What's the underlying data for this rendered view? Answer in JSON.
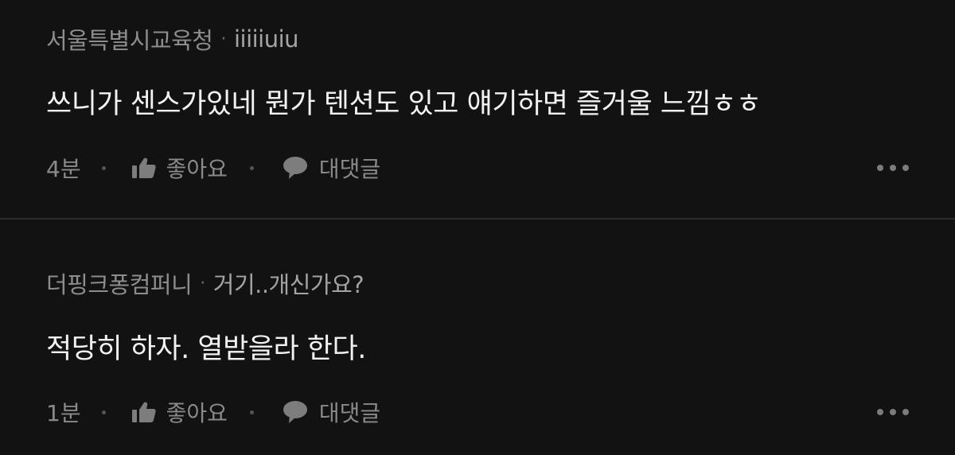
{
  "comments": [
    {
      "company": "서울특별시교육청",
      "separator": "·",
      "nickname": "iiiiiuiu",
      "text": "쓰니가 센스가있네 뭔가 텐션도 있고 얘기하면 즐거울 느낌ㅎㅎ",
      "time": "4분",
      "like_label": "좋아요",
      "reply_label": "대댓글",
      "like_icon": "thumbs-up-icon",
      "reply_icon": "speech-bubble-icon",
      "more_icon": "more-dots-icon"
    },
    {
      "company": "더핑크퐁컴퍼니",
      "separator": "·",
      "nickname": "거기..개신가요?",
      "text": "적당히 하자. 열받을라 한다.",
      "time": "1분",
      "like_label": "좋아요",
      "reply_label": "대댓글",
      "like_icon": "thumbs-up-icon",
      "reply_icon": "speech-bubble-icon",
      "more_icon": "more-dots-icon"
    }
  ],
  "colors": {
    "background": "#121212",
    "divider": "#2c2c2c",
    "meta_text": "#8d8d8d",
    "body_text": "#f2f2f2",
    "action_text": "#8a8a8a"
  }
}
